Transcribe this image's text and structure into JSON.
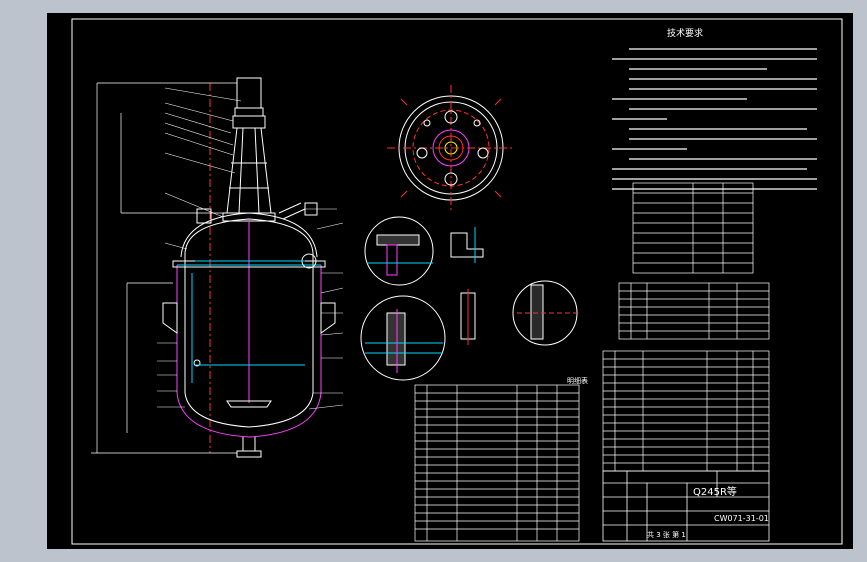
{
  "colors": {
    "background": "#bcc3cc",
    "sheet": "#000000",
    "frame": "#ffffff",
    "centerline": "#ff3030",
    "accent_cyan": "#00d8ff",
    "accent_magenta": "#ff40ff",
    "accent_yellow": "#ffff00",
    "accent_green": "#00ff66"
  },
  "title_block": {
    "material": "Q245R等",
    "drawing_no": "CW071-31-01",
    "sheet_label": "共 3 张 第 1"
  },
  "headings": {
    "technical_requirements": "技术要求",
    "parts_table": "明细表"
  }
}
